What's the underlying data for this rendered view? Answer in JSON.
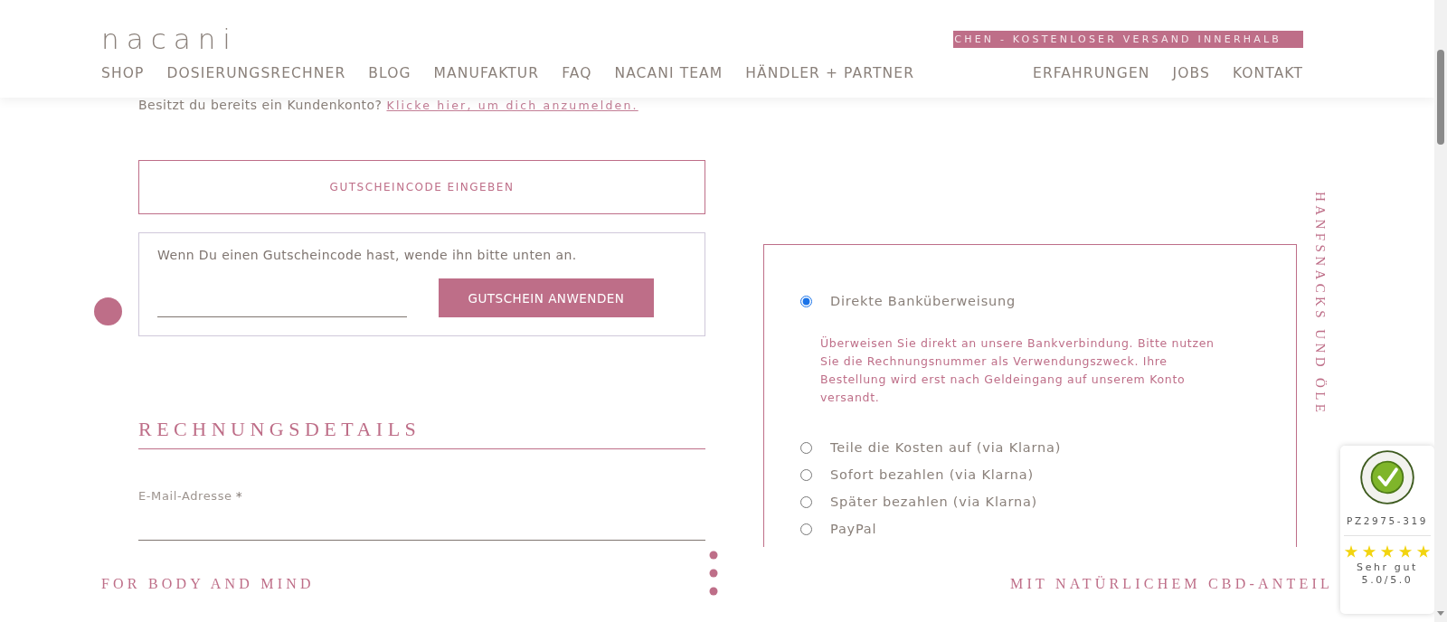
{
  "header": {
    "logo": "nacani",
    "ticker": "CHEN - KOSTENLOSER VERSAND INNERHALB",
    "nav_left": [
      "SHOP",
      "DOSIERUNGSRECHNER",
      "BLOG",
      "MANUFAKTUR",
      "FAQ",
      "NACANI TEAM",
      "HÄNDLER + PARTNER"
    ],
    "nav_right": [
      "ERFAHRUNGEN",
      "JOBS",
      "KONTAKT"
    ]
  },
  "login_prompt": {
    "text": "Besitzt du bereits ein Kundenkonto?",
    "link": "Klicke hier, um dich anzumelden."
  },
  "coupon": {
    "toggle": "GUTSCHEINCODE EINGEBEN",
    "hint": "Wenn Du einen Gutscheincode hast, wende ihn bitte unten an.",
    "button": "GUTSCHEIN ANWENDEN"
  },
  "billing": {
    "heading": "RECHNUNGSDETAILS",
    "email_label": "E-Mail-Adresse",
    "required_mark": "*"
  },
  "payment_methods": [
    {
      "label": "Direkte Banküberweisung",
      "selected": true,
      "description": "Überweisen Sie direkt an unsere Bankverbindung. Bitte nutzen Sie die Rechnungsnummer als Verwendungszweck. Ihre Bestellung wird erst nach Geldeingang auf unserem Konto versandt."
    },
    {
      "label": "Teile die Kosten auf (via Klarna)",
      "selected": false
    },
    {
      "label": "Sofort bezahlen (via Klarna)",
      "selected": false
    },
    {
      "label": "Später bezahlen (via Klarna)",
      "selected": false
    },
    {
      "label": "PayPal",
      "selected": false
    }
  ],
  "side_text": "HANFSNACKS UND ÖLE",
  "footer_strip": {
    "left": "FOR BODY AND MIND",
    "right": "MIT NATÜRLICHEM CBD-ANTEIL"
  },
  "trust_badge": {
    "id": "PZ2975-319",
    "stars": 5,
    "rating": "Sehr gut",
    "score": "5.0/5.0"
  }
}
